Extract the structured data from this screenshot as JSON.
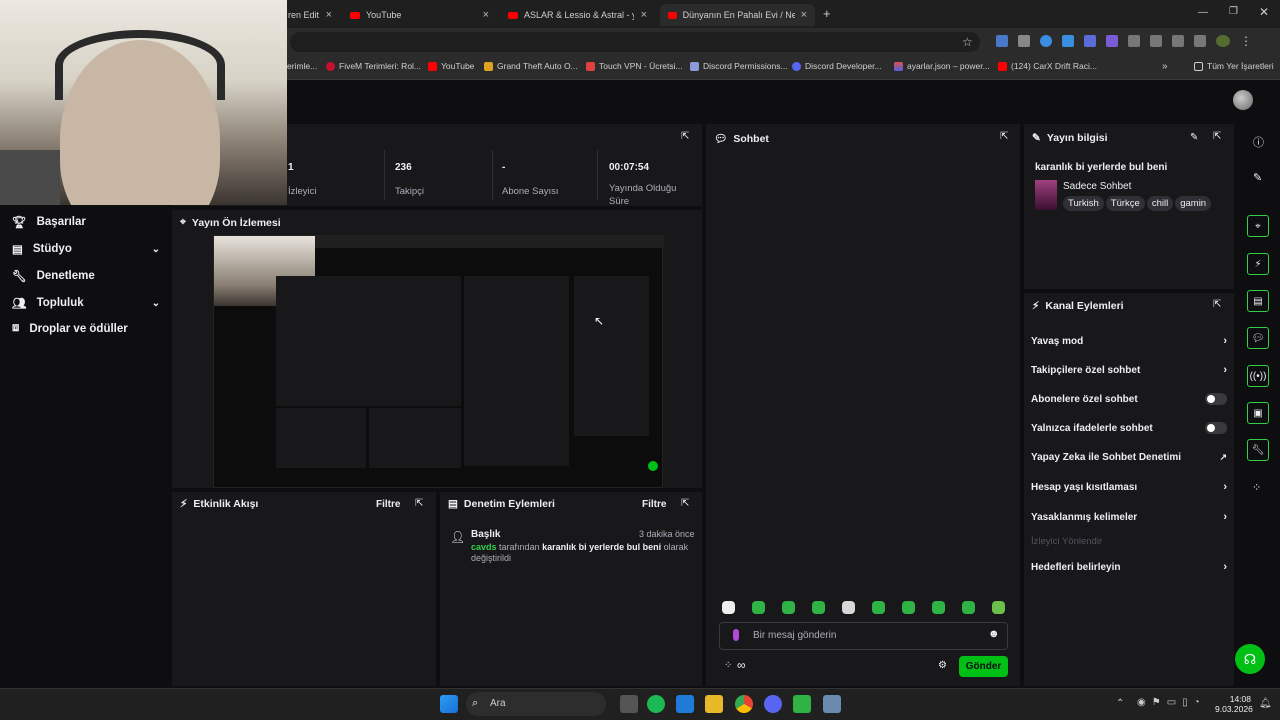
{
  "browser": {
    "tabs": [
      {
        "label": "ren Edit"
      },
      {
        "label": "YouTube"
      },
      {
        "label": "ASLAR & Lessio & Astral - yeni"
      },
      {
        "label": "Dünyanın En Pahalı Evi / New Y"
      }
    ],
    "new_tab": "+",
    "bookmarks": [
      {
        "label": "erimle..."
      },
      {
        "label": "FiveM Terimleri: Rol..."
      },
      {
        "label": "YouTube"
      },
      {
        "label": "Grand Theft Auto O..."
      },
      {
        "label": "Touch VPN - Ücretsi..."
      },
      {
        "label": "Discord Permissions..."
      },
      {
        "label": "Discord Developer..."
      },
      {
        "label": "ayarlar.json – power..."
      },
      {
        "label": "(124) CarX Drift Raci..."
      }
    ],
    "all_bookmarks": "Tüm Yer İşaretleri"
  },
  "sidebar": {
    "items": [
      {
        "label": "Başarılar"
      },
      {
        "label": "Stüdyo"
      },
      {
        "label": "Denetleme"
      },
      {
        "label": "Topluluk"
      },
      {
        "label": "Droplar ve ödüller"
      }
    ]
  },
  "stats": [
    {
      "value": "1",
      "label": "İzleyici"
    },
    {
      "value": "236",
      "label": "Takipçi"
    },
    {
      "value": "-",
      "label": "Abone Sayısı"
    },
    {
      "value": "00:07:54",
      "label": "Yayında Olduğu Süre"
    }
  ],
  "preview": {
    "title": "Yayın Ön İzlemesi"
  },
  "activity": {
    "title": "Etkinlik Akışı",
    "filter": "Filtre"
  },
  "modlog": {
    "title": "Denetim Eylemleri",
    "filter": "Filtre",
    "entry": {
      "heading": "Başlık",
      "time": "3 dakika önce",
      "user": "cavds",
      "text1": "tarafından",
      "title_value": "karanlık bi yerlerde bul beni",
      "text2": "olarak değiştirildi"
    }
  },
  "chat": {
    "title": "Sohbet",
    "placeholder": "Bir mesaj gönderin",
    "send": "Gönder",
    "points": "∞"
  },
  "stream_info": {
    "title": "Yayın bilgisi",
    "stream_title": "karanlık bi yerlerde bul beni",
    "category": "Sadece Sohbet",
    "tags": [
      "Turkish",
      "Türkçe",
      "chill",
      "gamin"
    ]
  },
  "channel_actions": {
    "title": "Kanal Eylemleri",
    "items": [
      {
        "label": "Yavaş mod"
      },
      {
        "label": "Takipçilere özel sohbet"
      },
      {
        "label": "Abonelere özel sohbet"
      },
      {
        "label": "Yalnızca ifadelerle sohbet"
      },
      {
        "label": "Yapay Zeka ile Sohbet Denetimi"
      },
      {
        "label": "Hesap yaşı kısıtlaması"
      },
      {
        "label": "Yasaklanmış kelimeler"
      },
      {
        "label": "İzleyici Yönlendir"
      },
      {
        "label": "Hedefleri belirleyin"
      }
    ]
  },
  "taskbar": {
    "search": "Ara",
    "time": "14:08",
    "date": "9.03.2026"
  },
  "colors": {
    "accent": "#00c016",
    "panel": "#18181b",
    "bg": "#0e0e10"
  }
}
